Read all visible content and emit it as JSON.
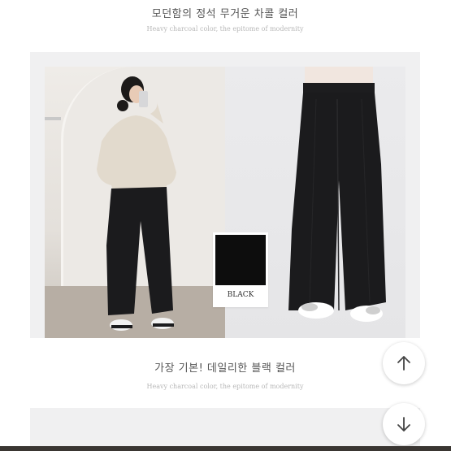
{
  "top_caption": {
    "title": "모던함의 정석 무거운 차콜 컬러",
    "subtitle": "Heavy charcoal color, the epitome of modernity"
  },
  "color_card": {
    "label": "BLACK",
    "swatch_color": "#0d0d0d"
  },
  "bottom_caption": {
    "title": "가장 기본! 데일리한 블랙 컬러",
    "subtitle": "Heavy charcoal color, the epitome of modernity"
  },
  "icons": {
    "scroll_up": "arrow-up-icon",
    "scroll_down": "arrow-down-icon"
  },
  "colors": {
    "panel_bg": "#f0f0f1",
    "pants": "#1b1b1d",
    "sweater": "#e2dacd"
  }
}
